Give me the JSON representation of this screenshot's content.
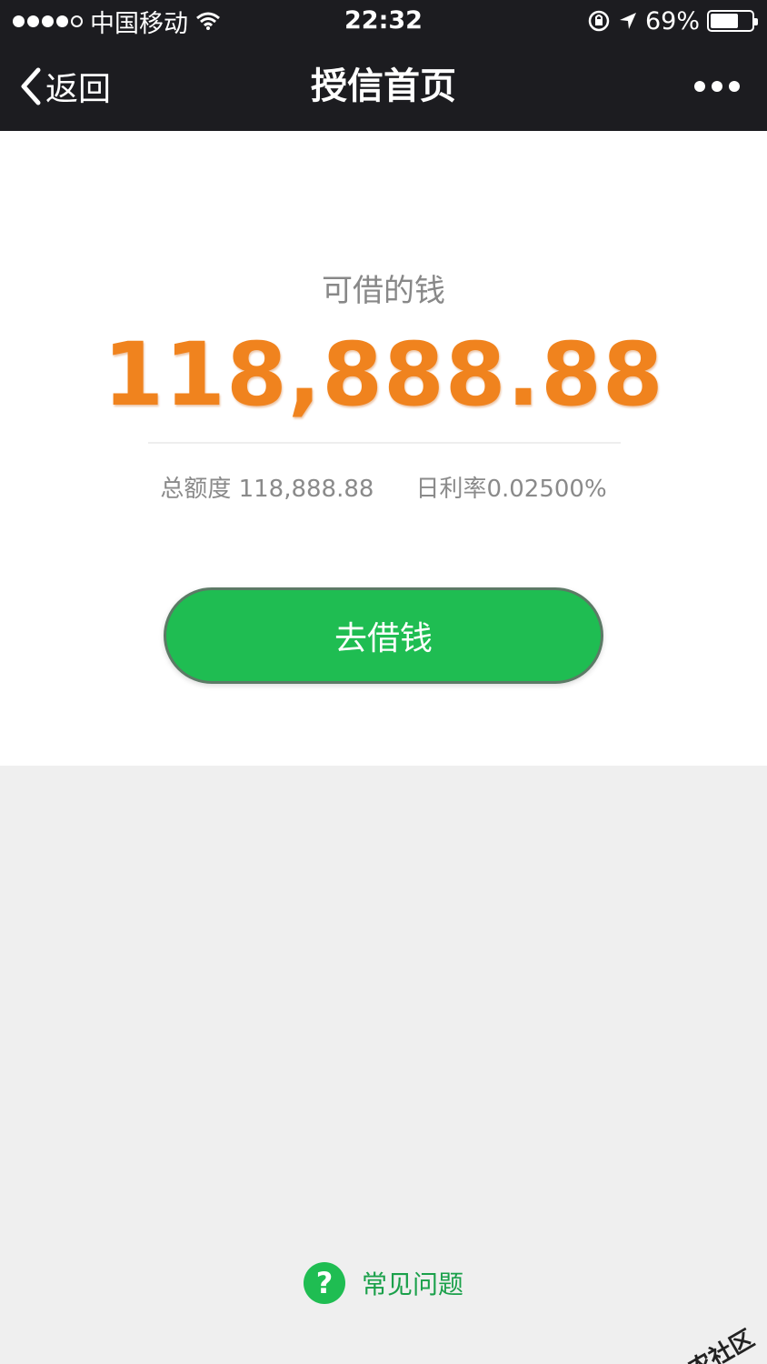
{
  "status_bar": {
    "carrier": "中国移动",
    "time": "22:32",
    "battery": "69%",
    "battery_level": 0.69
  },
  "nav": {
    "back_label": "返回",
    "title": "授信首页"
  },
  "credit": {
    "available_label": "可借的钱",
    "available_amount": "118,888.88",
    "total_label": "总额度 118,888.88",
    "daily_rate_label": "日利率0.02500%"
  },
  "actions": {
    "borrow_label": "去借钱"
  },
  "faq": {
    "icon_glyph": "?",
    "label": "常见问题"
  },
  "watermark": {
    "text": "卡农社区"
  },
  "colors": {
    "bar_bg": "#1c1c20",
    "accent_green": "#1fbd52",
    "amount_orange": "#f0831e"
  }
}
